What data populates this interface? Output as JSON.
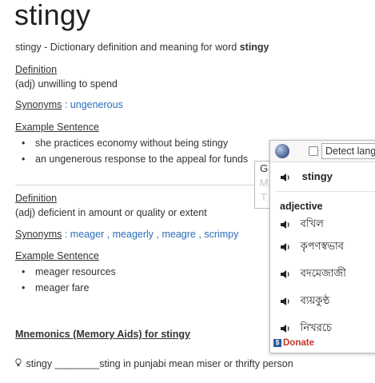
{
  "title": "stingy",
  "intro": {
    "prefix": "stingy - Dictionary definition and meaning for word ",
    "word": "stingy"
  },
  "meanings": [
    {
      "definition_label": "Definition",
      "definition": "(adj) unwilling to spend",
      "synonyms_label": "Synonyms",
      "synonyms": [
        "ungenerous"
      ],
      "example_label": "Example Sentence",
      "examples": [
        "she practices economy without being stingy",
        "an ungenerous response to the appeal for funds"
      ]
    },
    {
      "definition_label": "Definition",
      "definition": "(adj) deficient in amount or quality or extent",
      "synonyms_label": "Synonyms",
      "synonyms": [
        "meager",
        "meagerly",
        "meagre",
        "scrimpy"
      ],
      "example_label": "Example Sentence",
      "examples": [
        "meager resources",
        "meager fare"
      ]
    }
  ],
  "mnemonics": {
    "heading": "Mnemonics (Memory Aids) for stingy",
    "text": "stingy ________sting in punjabi mean miser or thrifty person"
  },
  "popup": {
    "detect_label": "Detect lang",
    "gmt": [
      "G",
      "M",
      "T"
    ],
    "word": "stingy",
    "part_of_speech": "adjective",
    "translations": [
      "বখিল",
      "কৃপণস্বভাব",
      "বদমেজাজী",
      "ব্যয়কুণ্ঠ",
      "নিখরচে"
    ],
    "donate": "Donate"
  },
  "colors": {
    "link": "#2a6ebb",
    "donate": "#c0392b"
  }
}
